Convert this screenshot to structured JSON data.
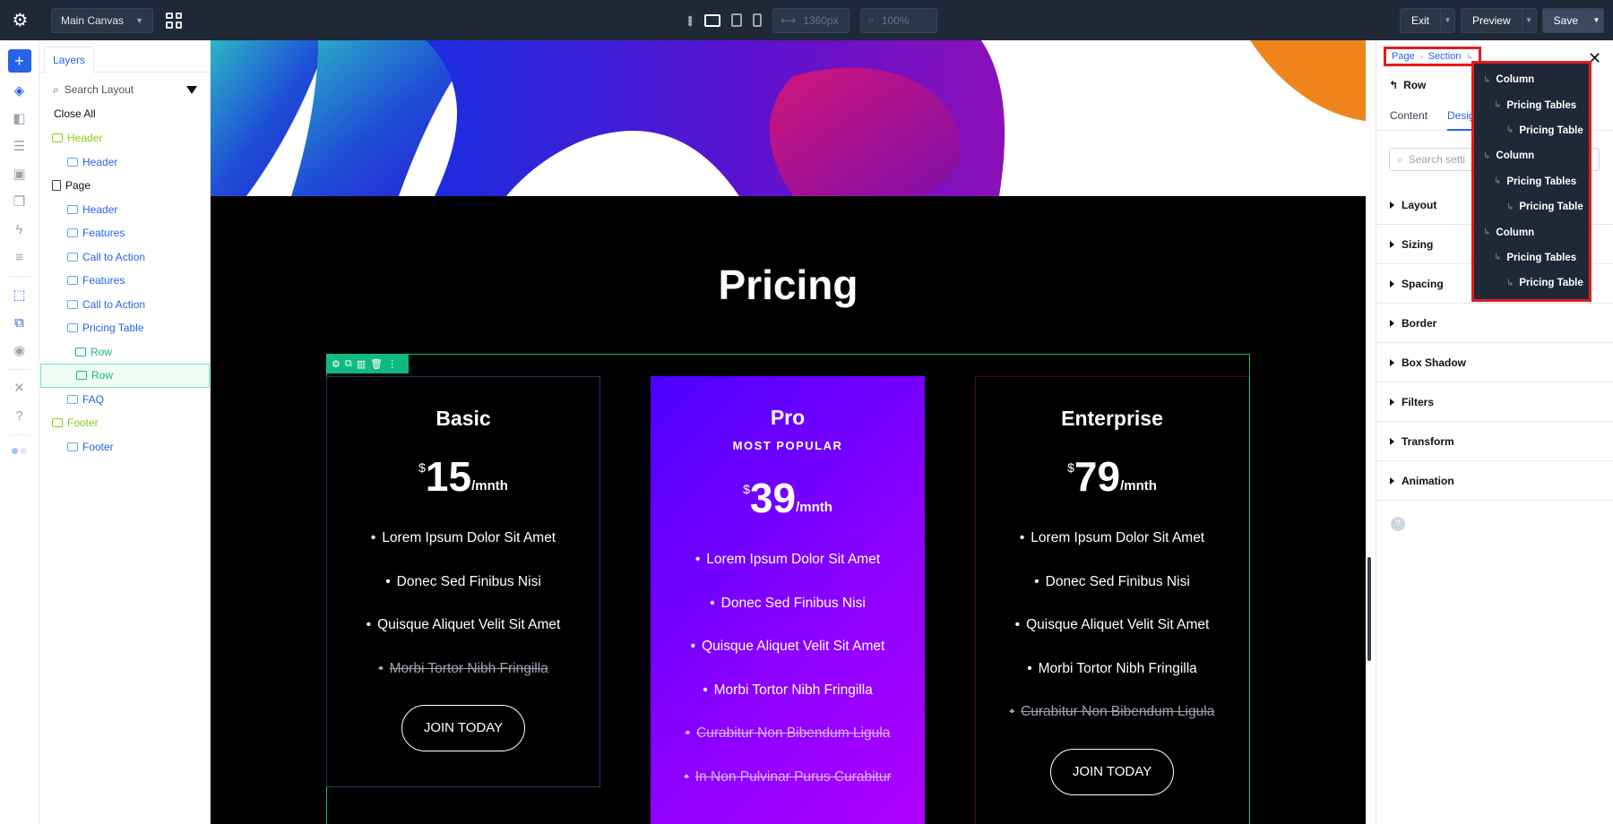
{
  "topbar": {
    "canvas_select": "Main Canvas",
    "width_value": "1360px",
    "zoom_value": "100%",
    "exit_label": "Exit",
    "preview_label": "Preview",
    "save_label": "Save"
  },
  "layers": {
    "tab": "Layers",
    "search_placeholder": "Search Layout",
    "close_all": "Close All",
    "items": [
      {
        "label": "Header",
        "indent": 0,
        "style": "green"
      },
      {
        "label": "Header",
        "indent": 1,
        "style": "blue"
      },
      {
        "label": "Page",
        "indent": 0,
        "style": "dark"
      },
      {
        "label": "Header",
        "indent": 1,
        "style": "blue"
      },
      {
        "label": "Features",
        "indent": 1,
        "style": "blue"
      },
      {
        "label": "Call to Action",
        "indent": 1,
        "style": "blue"
      },
      {
        "label": "Features",
        "indent": 1,
        "style": "blue"
      },
      {
        "label": "Call to Action",
        "indent": 1,
        "style": "blue"
      },
      {
        "label": "Pricing Table",
        "indent": 1,
        "style": "blue"
      },
      {
        "label": "Row",
        "indent": 2,
        "style": "teal"
      },
      {
        "label": "Row",
        "indent": 2,
        "style": "teal",
        "selected": true
      },
      {
        "label": "FAQ",
        "indent": 1,
        "style": "blue"
      },
      {
        "label": "Footer",
        "indent": 0,
        "style": "green"
      },
      {
        "label": "Footer",
        "indent": 1,
        "style": "blue"
      }
    ]
  },
  "canvas": {
    "title": "Pricing",
    "cards": [
      {
        "name": "Basic",
        "subtitle": "",
        "currency": "$",
        "price": "15",
        "period": "/mnth",
        "features": [
          {
            "text": "Lorem Ipsum Dolor Sit Amet",
            "off": false
          },
          {
            "text": "Donec Sed Finibus Nisi",
            "off": false
          },
          {
            "text": "Quisque Aliquet Velit Sit Amet",
            "off": false
          },
          {
            "text": "Morbi Tortor Nibh Fringilla",
            "off": true
          }
        ],
        "button": "JOIN TODAY"
      },
      {
        "name": "Pro",
        "subtitle": "MOST POPULAR",
        "currency": "$",
        "price": "39",
        "period": "/mnth",
        "features": [
          {
            "text": "Lorem Ipsum Dolor Sit Amet",
            "off": false
          },
          {
            "text": "Donec Sed Finibus Nisi",
            "off": false
          },
          {
            "text": "Quisque Aliquet Velit Sit Amet",
            "off": false
          },
          {
            "text": "Morbi Tortor Nibh Fringilla",
            "off": false
          },
          {
            "text": "Curabitur Non Bibendum Ligula",
            "off": true
          },
          {
            "text": "In Non Pulvinar Purus Curabitur",
            "off": true
          }
        ],
        "button": ""
      },
      {
        "name": "Enterprise",
        "subtitle": "",
        "currency": "$",
        "price": "79",
        "period": "/mnth",
        "features": [
          {
            "text": "Lorem Ipsum Dolor Sit Amet",
            "off": false
          },
          {
            "text": "Donec Sed Finibus Nisi",
            "off": false
          },
          {
            "text": "Quisque Aliquet Velit Sit Amet",
            "off": false
          },
          {
            "text": "Morbi Tortor Nibh Fringilla",
            "off": false
          },
          {
            "text": "Curabitur Non Bibendum Ligula",
            "off": true
          }
        ],
        "button": "JOIN TODAY"
      }
    ]
  },
  "panel": {
    "breadcrumbs": [
      "Page",
      "Section"
    ],
    "element_label": "Row",
    "tabs": [
      "Content",
      "Desig"
    ],
    "search_placeholder": "Search setti",
    "sections": [
      "Layout",
      "Sizing",
      "Spacing",
      "Border",
      "Box Shadow",
      "Filters",
      "Transform",
      "Animation"
    ]
  },
  "dropdown": {
    "items": [
      {
        "label": "Column",
        "level": 0
      },
      {
        "label": "Pricing Tables",
        "level": 1
      },
      {
        "label": "Pricing Table",
        "level": 2
      },
      {
        "label": "Column",
        "level": 0
      },
      {
        "label": "Pricing Tables",
        "level": 1
      },
      {
        "label": "Pricing Table",
        "level": 2
      },
      {
        "label": "Column",
        "level": 0
      },
      {
        "label": "Pricing Tables",
        "level": 1
      },
      {
        "label": "Pricing Table",
        "level": 2
      }
    ]
  },
  "colors": {
    "accent": "#2563eb",
    "topbar_bg": "#1e2836",
    "selection": "#10b981",
    "highlight_box": "#e11d1d",
    "pro_card": "#8a00ff"
  }
}
